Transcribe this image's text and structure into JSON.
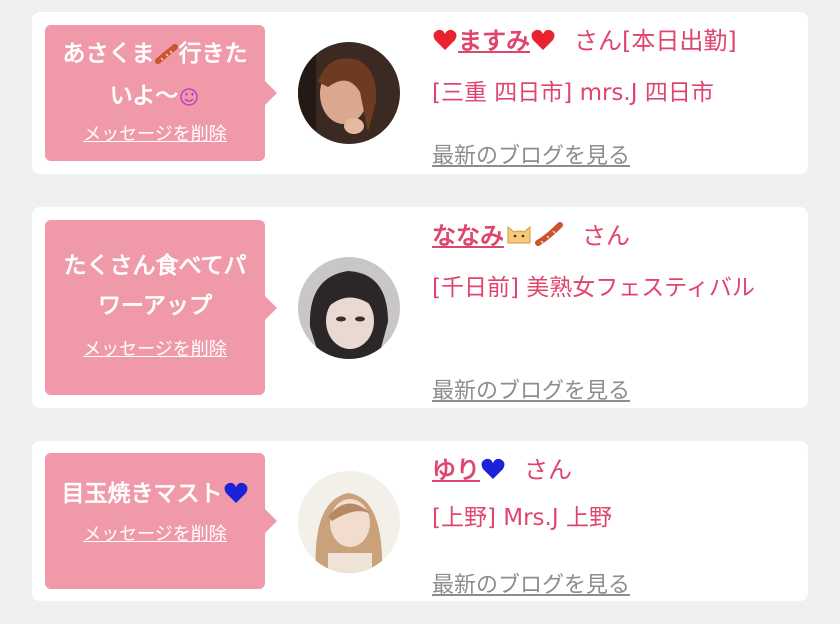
{
  "delete_label": "メッセージを削除",
  "blog_label": "最新のブログを見る",
  "colors": {
    "bubble": "#f09aa9",
    "accent": "#e0456d",
    "blog_link": "#8d8d8d",
    "card": "#ffffff",
    "page_bg": "#f0eff2"
  },
  "messages": [
    {
      "message": "あさくま",
      "message_icon": "sausage-icon",
      "message_rest": "行きたいよ～",
      "message_end_icon": "heart-eyes-icon",
      "name": "ますみ",
      "name_prefix_icon": "red-heart-icon",
      "name_suffix_icon": "red-heart-icon",
      "honorific": "さん",
      "status": "[本日出勤]",
      "shop": "[三重 四日市] mrs.J 四日市"
    },
    {
      "message": "たくさん食べてパワーアップ",
      "name": "ななみ",
      "name_suffix_icon": "cat-sausage-icon",
      "honorific": "さん",
      "shop": "[千日前] 美熟女フェスティバル"
    },
    {
      "message": "目玉焼きマスト",
      "message_end_icon": "blue-heart-icon",
      "name": "ゆり",
      "name_suffix_icon": "blue-heart-icon",
      "honorific": "さん",
      "shop": "[上野] Mrs.J 上野"
    }
  ]
}
